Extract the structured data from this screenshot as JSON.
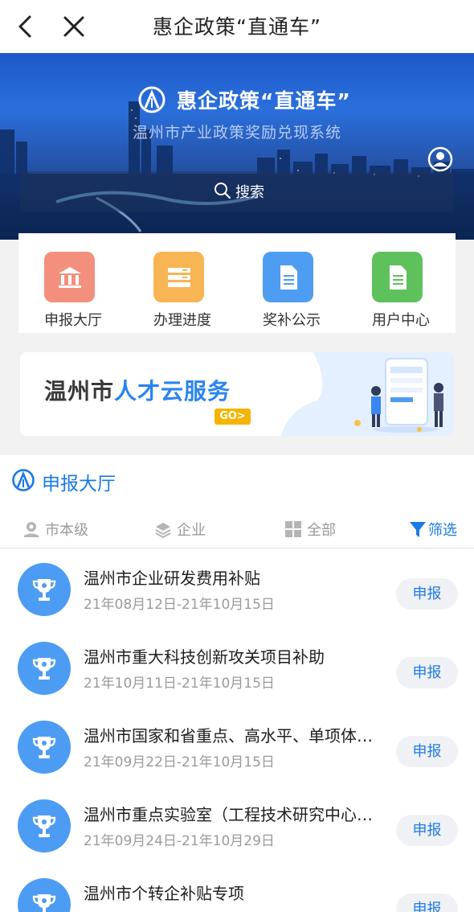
{
  "nav": {
    "title": "惠企政策“直通车”"
  },
  "banner": {
    "title": "惠企政策“直通车”",
    "subtitle": "温州市产业政策奖励兑现系统",
    "search_label": "搜索"
  },
  "quick_menu": [
    {
      "label": "申报大厅",
      "icon": "bank-icon",
      "color": "#f2907d"
    },
    {
      "label": "办理进度",
      "icon": "progress-icon",
      "color": "#f7b553"
    },
    {
      "label": "奖补公示",
      "icon": "document-icon",
      "color": "#4e9df3"
    },
    {
      "label": "用户中心",
      "icon": "user-document-icon",
      "color": "#5fc15c"
    }
  ],
  "promo": {
    "text_prefix": "温州市",
    "text_accent": "人才云服务",
    "go_label": "GO>"
  },
  "section": {
    "title": "申报大厅",
    "filters": [
      {
        "label": "市本级",
        "icon": "location-icon"
      },
      {
        "label": "企业",
        "icon": "layers-icon"
      },
      {
        "label": "全部",
        "icon": "grid-icon"
      },
      {
        "label": "筛选",
        "icon": "filter-icon"
      }
    ],
    "items": [
      {
        "title": "温州市企业研发费用补贴",
        "date": "21年08月12日-21年10月15日",
        "button": "申报"
      },
      {
        "title": "温州市重大科技创新攻关项目补助",
        "date": "21年10月11日-21年10月15日",
        "button": "申报"
      },
      {
        "title": "温州市国家和省重点、高水平、单项体…",
        "date": "21年09月22日-21年10月15日",
        "button": "申报"
      },
      {
        "title": "温州市重点实验室（工程技术研究中心…",
        "date": "21年09月24日-21年10月29日",
        "button": "申报"
      },
      {
        "title": "温州市个转企补贴专项",
        "date": "",
        "button": "申报"
      }
    ]
  },
  "colors": {
    "accent": "#1a78e5",
    "item_icon": "#4d9cf3"
  }
}
